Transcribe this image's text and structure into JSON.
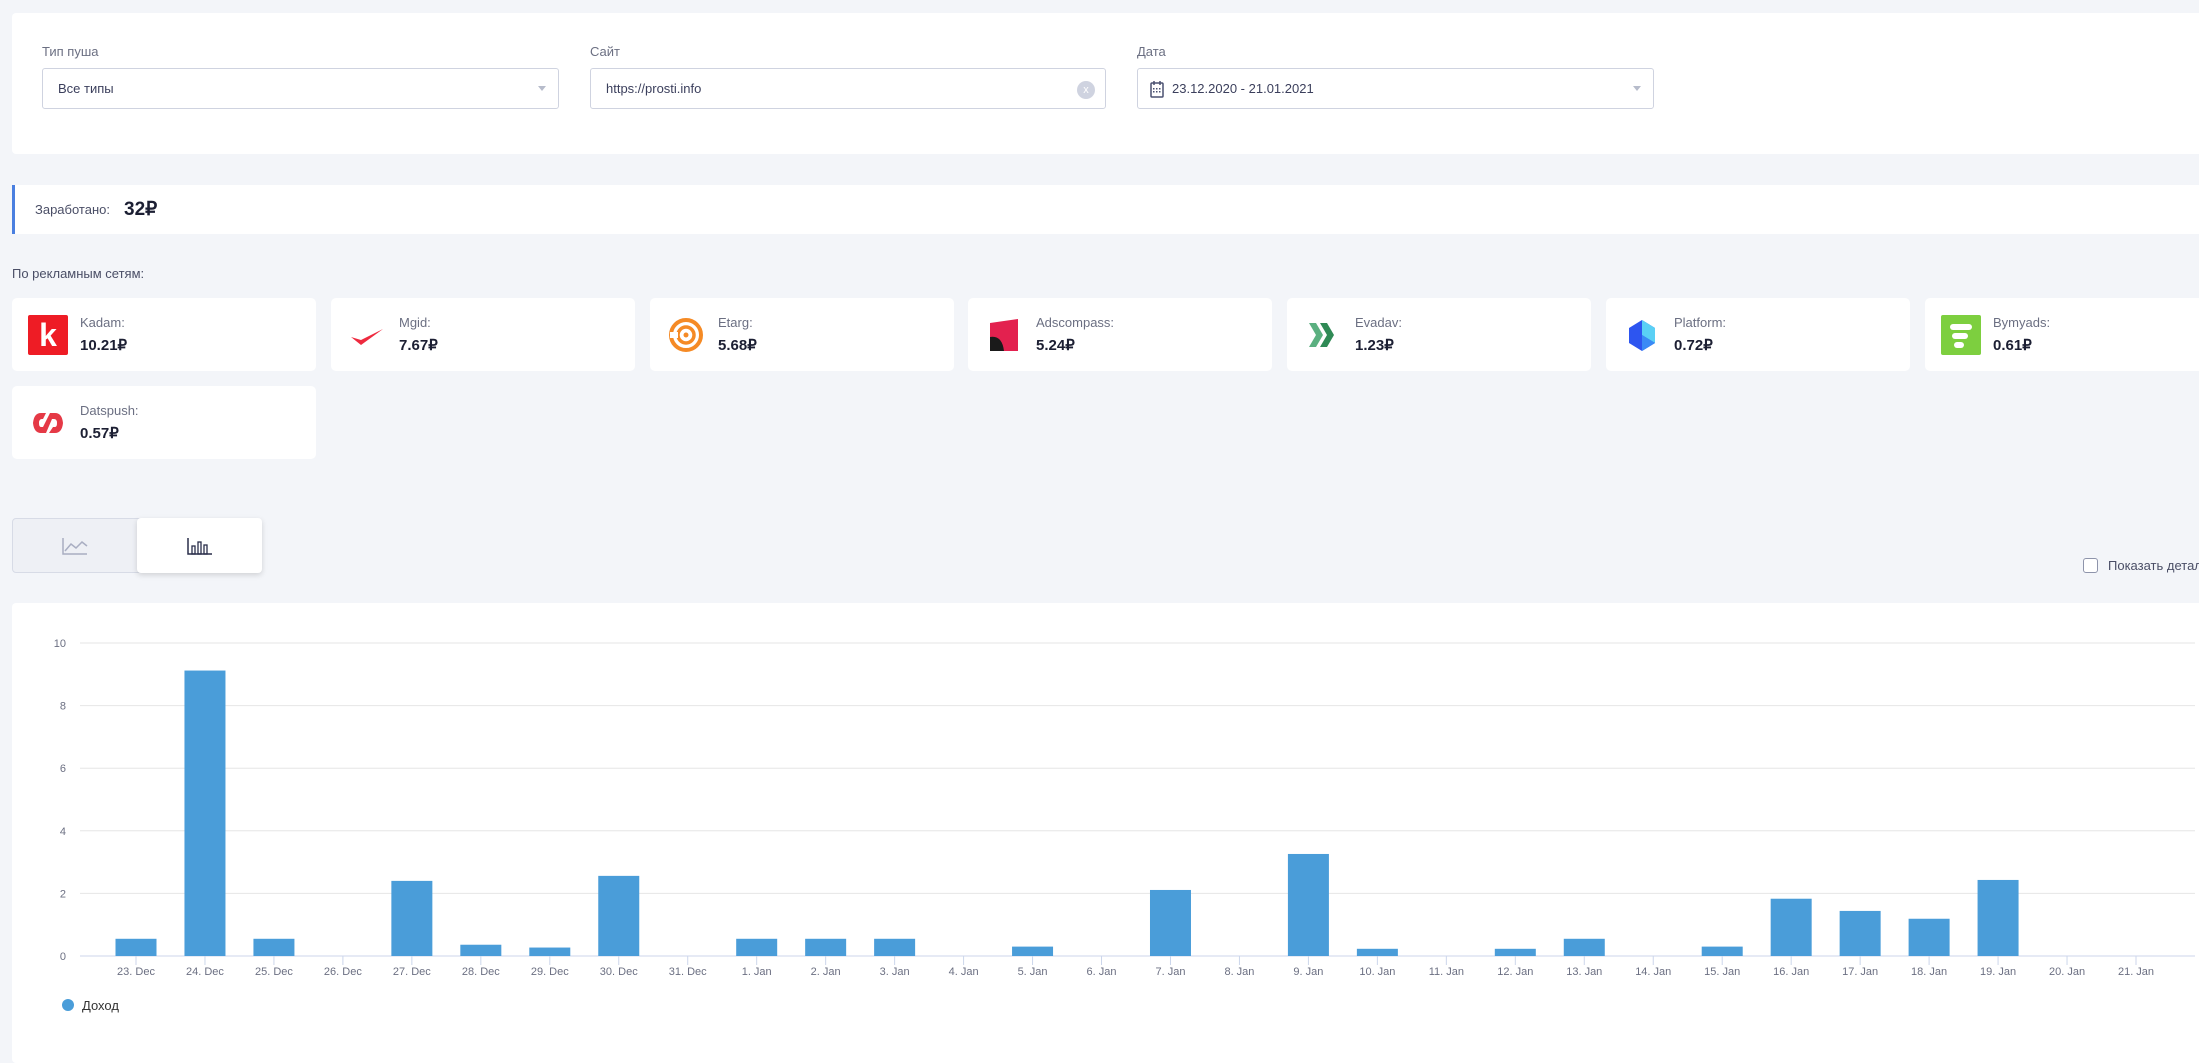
{
  "filters": {
    "push_type": {
      "label": "Тип пуша",
      "value": "Все типы"
    },
    "site": {
      "label": "Сайт",
      "value": "https://prosti.info"
    },
    "date": {
      "label": "Дата",
      "value": "23.12.2020 - 21.01.2021"
    }
  },
  "earned": {
    "label": "Заработано:",
    "value": "32₽"
  },
  "networks_title": "По рекламным сетям:",
  "networks": [
    {
      "name": "Kadam:",
      "value": "10.21₽",
      "icon": "kadam-logo"
    },
    {
      "name": "Mgid:",
      "value": "7.67₽",
      "icon": "mgid-logo"
    },
    {
      "name": "Etarg:",
      "value": "5.68₽",
      "icon": "etarg-logo"
    },
    {
      "name": "Adscompass:",
      "value": "5.24₽",
      "icon": "adscompass-logo"
    },
    {
      "name": "Evadav:",
      "value": "1.23₽",
      "icon": "evadav-logo"
    },
    {
      "name": "Platform:",
      "value": "0.72₽",
      "icon": "platform-logo"
    },
    {
      "name": "Bymyads:",
      "value": "0.61₽",
      "icon": "bymyads-logo"
    },
    {
      "name": "Datspush:",
      "value": "0.57₽",
      "icon": "datspush-logo"
    }
  ],
  "view_toggle": {
    "options": [
      "line-chart-icon",
      "bar-chart-icon"
    ],
    "active": "bar-chart-icon"
  },
  "details_checkbox": {
    "label": "Показать детализацию",
    "checked": false
  },
  "chart_data": {
    "type": "bar",
    "categories": [
      "23. Dec",
      "24. Dec",
      "25. Dec",
      "26. Dec",
      "27. Dec",
      "28. Dec",
      "29. Dec",
      "30. Dec",
      "31. Dec",
      "1. Jan",
      "2. Jan",
      "3. Jan",
      "4. Jan",
      "5. Jan",
      "6. Jan",
      "7. Jan",
      "8. Jan",
      "9. Jan",
      "10. Jan",
      "11. Jan",
      "12. Jan",
      "13. Jan",
      "14. Jan",
      "15. Jan",
      "16. Jan",
      "17. Jan",
      "18. Jan",
      "19. Jan",
      "20. Jan",
      "21. Jan"
    ],
    "series": [
      {
        "name": "Доход",
        "color": "#4a9dd9",
        "values": [
          0.55,
          9.12,
          0.55,
          0,
          2.4,
          0.36,
          0.27,
          2.56,
          0,
          0.55,
          0.55,
          0.55,
          0,
          0.3,
          0,
          2.11,
          0,
          3.26,
          0.23,
          0,
          0.23,
          0.55,
          0,
          0.3,
          1.83,
          1.44,
          1.19,
          2.43,
          0,
          0
        ]
      }
    ],
    "yticks": [
      "0",
      "2",
      "4",
      "6",
      "8",
      "10"
    ],
    "ylim": [
      0,
      10
    ],
    "grid": true,
    "legend": "bottom-left"
  }
}
